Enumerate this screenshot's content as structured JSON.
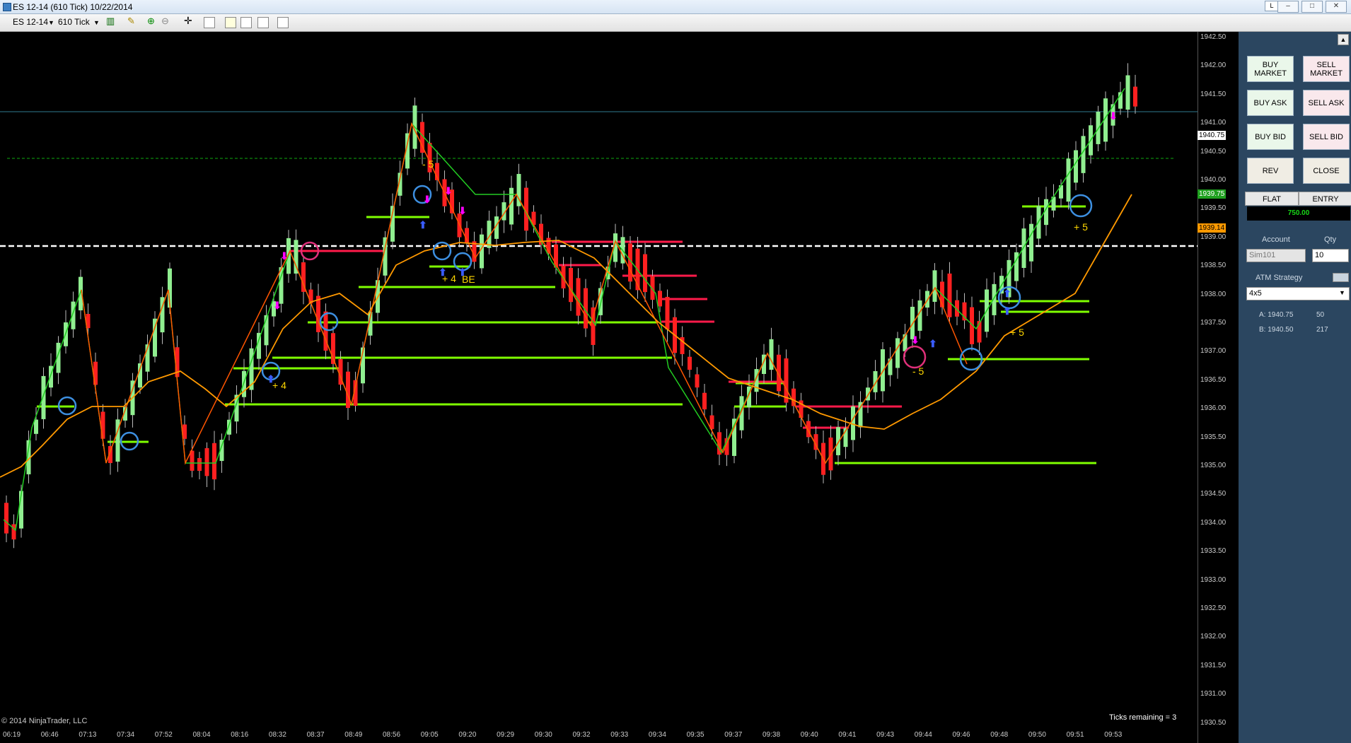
{
  "window": {
    "title": "ES 12-14 (610 Tick)  10/22/2014",
    "restore_label": "L"
  },
  "toolbar": {
    "instrument": "ES 12-14",
    "period": "610 Tick"
  },
  "chart": {
    "copyright": "© 2014 NinjaTrader, LLC",
    "ticks_remaining": "Ticks remaining = 3",
    "y_ticks": [
      "1942.50",
      "1942.00",
      "1941.50",
      "1941.00",
      "1940.50",
      "1940.00",
      "1939.50",
      "1939.00",
      "1938.50",
      "1938.00",
      "1937.50",
      "1937.00",
      "1936.50",
      "1936.00",
      "1935.50",
      "1935.00",
      "1934.50",
      "1934.00",
      "1933.50",
      "1933.00",
      "1932.50",
      "1932.00",
      "1931.50",
      "1931.00",
      "1930.50"
    ],
    "x_ticks": [
      "06:19",
      "06:46",
      "07:13",
      "07:34",
      "07:52",
      "08:04",
      "08:16",
      "08:32",
      "08:37",
      "08:49",
      "08:56",
      "09:05",
      "09:20",
      "09:29",
      "09:30",
      "09:32",
      "09:33",
      "09:34",
      "09:35",
      "09:37",
      "09:38",
      "09:40",
      "09:41",
      "09:43",
      "09:44",
      "09:46",
      "09:48",
      "09:50",
      "09:51",
      "09:53"
    ],
    "price_labels": {
      "last": "1940.75",
      "target": "1939.75",
      "avg": "1939.14"
    },
    "annotations": [
      "- 5",
      "+ 4",
      "BE",
      "+ 4",
      "- 5",
      "+ 5",
      "+ 5"
    ],
    "colors": {
      "up_bar": "#90ee90",
      "down_bar": "#ff2020",
      "zigzag": "#22cc22",
      "ma": "#ff9900",
      "support": "#7fff00",
      "resistance": "#ff1a4a"
    }
  },
  "panel": {
    "buy_market": "BUY MARKET",
    "sell_market": "SELL MARKET",
    "buy_ask": "BUY ASK",
    "sell_ask": "SELL ASK",
    "buy_bid": "BUY BID",
    "sell_bid": "SELL BID",
    "rev": "REV",
    "close": "CLOSE",
    "flat": "FLAT",
    "entry": "ENTRY",
    "pnl": "750.00",
    "account_label": "Account",
    "qty_label": "Qty",
    "account_value": "Sim101",
    "qty_value": "10",
    "atm_label": "ATM Strategy",
    "atm_value": "4x5",
    "ask_label": "A: 1940.75",
    "ask_size": "50",
    "bid_label": "B: 1940.50",
    "bid_size": "217"
  }
}
